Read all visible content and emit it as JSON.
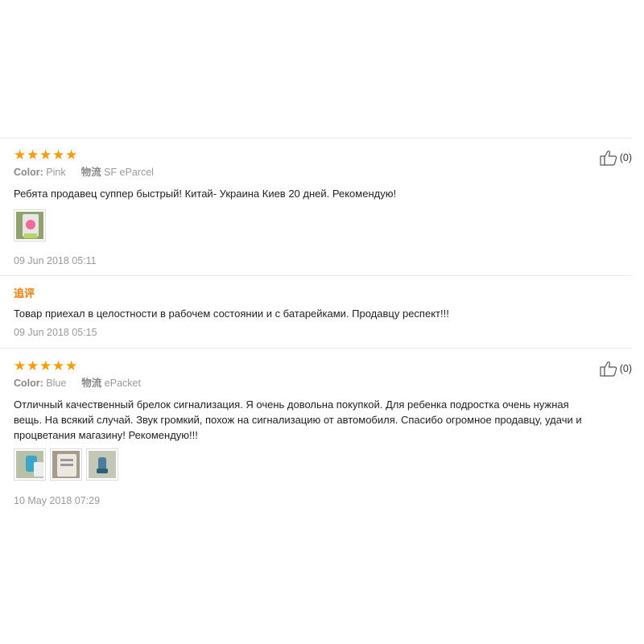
{
  "reviews": [
    {
      "stars": [
        "★",
        "★",
        "★",
        "★",
        "★"
      ],
      "color_label": "Color:",
      "color_value": "Pink",
      "shipping_label": "物流",
      "shipping_value": "SF eParcel",
      "text": "Ребята продавец суппер быстрый! Китай- Украина Киев 20 дней. Рекомендую!",
      "date": "09 Jun 2018 05:11",
      "likes": "(0)",
      "followup": {
        "label": "追评",
        "text": "Товар приехал в целостности в рабочем состоянии и с батарейками. Продавцу респект!!!",
        "date": "09 Jun 2018 05:15"
      }
    },
    {
      "stars": [
        "★",
        "★",
        "★",
        "★",
        "★"
      ],
      "color_label": "Color:",
      "color_value": "Blue",
      "shipping_label": "物流",
      "shipping_value": "ePacket",
      "text_lines": [
        "Отличный качественный брелок сигнализация. Я очень довольна покупкой. Для ребенка подростка очень нужная",
        "вещь. На всякий случай. Звук громкий, похож на сигнализацию от автомобиля. Спасибо огромное продавцу, удачи и",
        "процветания магазину! Рекомендую!!!"
      ],
      "date": "10 May 2018 07:29",
      "likes": "(0)"
    }
  ],
  "colors": {
    "star": "#ff9a00",
    "followup_label": "#ff7a00",
    "muted_text": "#999999"
  }
}
